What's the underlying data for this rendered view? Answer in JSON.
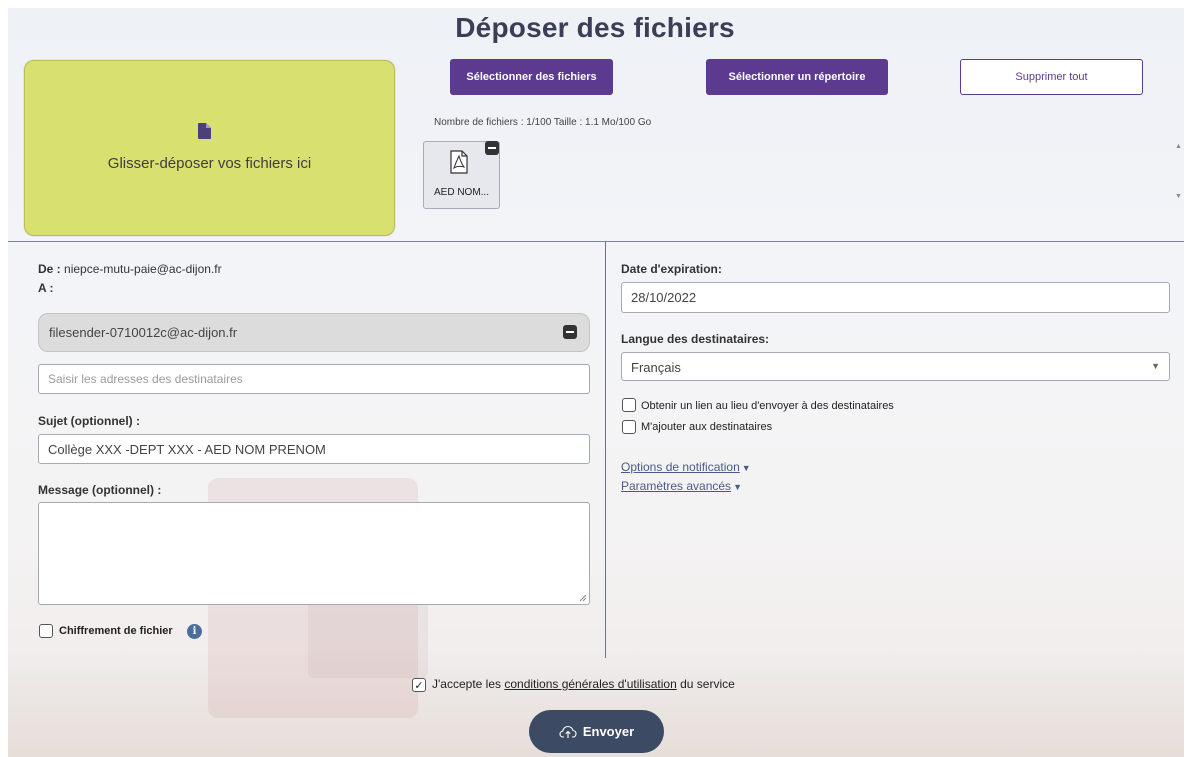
{
  "page": {
    "title": "Déposer des fichiers",
    "accent_color": "#5b3a90",
    "dropzone_color": "#d8e070"
  },
  "dropzone": {
    "label": "Glisser-déposer vos fichiers ici",
    "icon": "file-icon"
  },
  "toolbar": {
    "select_files": "Sélectionner des fichiers",
    "select_directory": "Sélectionner un répertoire",
    "delete_all": "Supprimer tout"
  },
  "file_stats": "Nombre de fichiers : 1/100 Taille : 1.1 Mo/100 Go",
  "files": [
    {
      "name": "AED NOM...",
      "icon": "pdf-icon"
    }
  ],
  "form": {
    "from_label": "De :",
    "from_value": "niepce-mutu-paie@ac-dijon.fr",
    "to_label": "A :",
    "recipient": "filesender-0710012c@ac-dijon.fr",
    "recipient_placeholder": "Saisir les adresses des destinataires",
    "subject_label": "Sujet (optionnel) :",
    "subject_value": "Collège XXX -DEPT XXX - AED NOM PRENOM",
    "message_label": "Message (optionnel) :",
    "encryption_label": "Chiffrement de fichier",
    "expiration_label": "Date d'expiration:",
    "expiration_value": "28/10/2022",
    "language_label": "Langue des destinataires:",
    "language_value": "Français",
    "get_link_label": "Obtenir un lien au lieu d'envoyer à des destinataires",
    "add_me_label": "M'ajouter aux destinataires",
    "notification_options": "Options de notification",
    "advanced_settings": "Paramètres avancés"
  },
  "footer": {
    "accept_prefix": "J'accepte les",
    "accept_link": "conditions générales d'utilisation",
    "accept_suffix": "du service",
    "accept_checked": true,
    "send_label": "Envoyer"
  }
}
